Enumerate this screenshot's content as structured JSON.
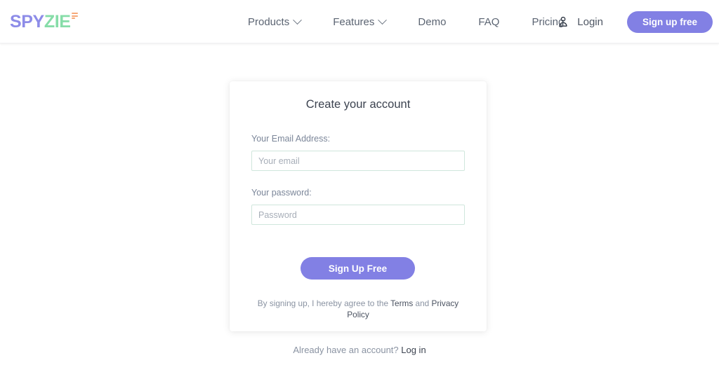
{
  "brand": {
    "name_part1": "SPY",
    "name_part2": "ZIE",
    "trademark_icon": "trademark-bars-icon",
    "purple": "#8280e4",
    "green": "#86dda8",
    "orange": "#f6a878"
  },
  "header": {
    "nav": [
      {
        "label": "Products",
        "has_dropdown": true
      },
      {
        "label": "Features",
        "has_dropdown": true
      },
      {
        "label": "Demo",
        "has_dropdown": false
      },
      {
        "label": "FAQ",
        "has_dropdown": false
      },
      {
        "label": "Pricing",
        "has_dropdown": false
      }
    ],
    "user_icon": "user-icon",
    "login_label": "Login",
    "signup_label": "Sign up free"
  },
  "card": {
    "title": "Create your account",
    "email": {
      "label": "Your Email Address:",
      "placeholder": "Your email",
      "value": ""
    },
    "password": {
      "label": "Your password:",
      "placeholder": "Password",
      "value": ""
    },
    "submit_label": "Sign Up Free",
    "terms": {
      "prefix": "By signing up, I hereby agree to the ",
      "terms_link": "Terms",
      "middle": " and ",
      "privacy_link": "Privacy Policy"
    }
  },
  "footer": {
    "prompt": "Already have an account? ",
    "login_link": "Log in"
  }
}
